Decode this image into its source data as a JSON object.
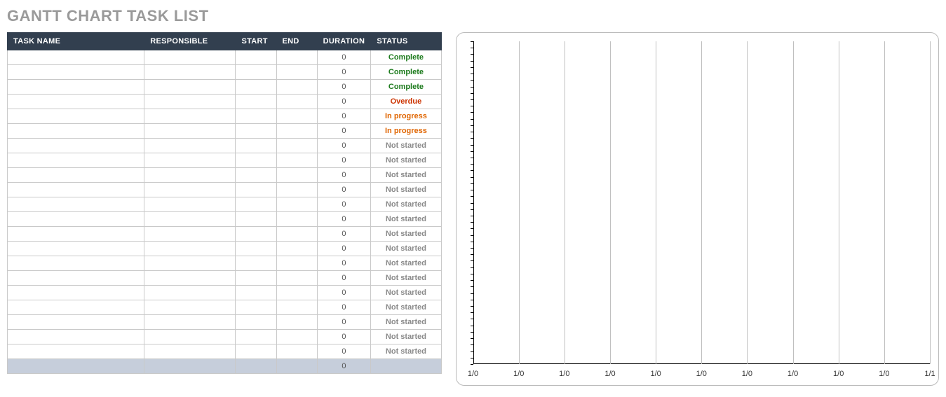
{
  "title": "GANTT CHART TASK LIST",
  "table": {
    "headers": {
      "taskname": "TASK NAME",
      "responsible": "RESPONSIBLE",
      "start": "START",
      "end": "END",
      "duration": "DURATION",
      "status": "STATUS"
    },
    "rows": [
      {
        "taskname": "",
        "responsible": "",
        "start": "",
        "end": "",
        "duration": "0",
        "status": "Complete"
      },
      {
        "taskname": "",
        "responsible": "",
        "start": "",
        "end": "",
        "duration": "0",
        "status": "Complete"
      },
      {
        "taskname": "",
        "responsible": "",
        "start": "",
        "end": "",
        "duration": "0",
        "status": "Complete"
      },
      {
        "taskname": "",
        "responsible": "",
        "start": "",
        "end": "",
        "duration": "0",
        "status": "Overdue"
      },
      {
        "taskname": "",
        "responsible": "",
        "start": "",
        "end": "",
        "duration": "0",
        "status": "In progress"
      },
      {
        "taskname": "",
        "responsible": "",
        "start": "",
        "end": "",
        "duration": "0",
        "status": "In progress"
      },
      {
        "taskname": "",
        "responsible": "",
        "start": "",
        "end": "",
        "duration": "0",
        "status": "Not started"
      },
      {
        "taskname": "",
        "responsible": "",
        "start": "",
        "end": "",
        "duration": "0",
        "status": "Not started"
      },
      {
        "taskname": "",
        "responsible": "",
        "start": "",
        "end": "",
        "duration": "0",
        "status": "Not started"
      },
      {
        "taskname": "",
        "responsible": "",
        "start": "",
        "end": "",
        "duration": "0",
        "status": "Not started"
      },
      {
        "taskname": "",
        "responsible": "",
        "start": "",
        "end": "",
        "duration": "0",
        "status": "Not started"
      },
      {
        "taskname": "",
        "responsible": "",
        "start": "",
        "end": "",
        "duration": "0",
        "status": "Not started"
      },
      {
        "taskname": "",
        "responsible": "",
        "start": "",
        "end": "",
        "duration": "0",
        "status": "Not started"
      },
      {
        "taskname": "",
        "responsible": "",
        "start": "",
        "end": "",
        "duration": "0",
        "status": "Not started"
      },
      {
        "taskname": "",
        "responsible": "",
        "start": "",
        "end": "",
        "duration": "0",
        "status": "Not started"
      },
      {
        "taskname": "",
        "responsible": "",
        "start": "",
        "end": "",
        "duration": "0",
        "status": "Not started"
      },
      {
        "taskname": "",
        "responsible": "",
        "start": "",
        "end": "",
        "duration": "0",
        "status": "Not started"
      },
      {
        "taskname": "",
        "responsible": "",
        "start": "",
        "end": "",
        "duration": "0",
        "status": "Not started"
      },
      {
        "taskname": "",
        "responsible": "",
        "start": "",
        "end": "",
        "duration": "0",
        "status": "Not started"
      },
      {
        "taskname": "",
        "responsible": "",
        "start": "",
        "end": "",
        "duration": "0",
        "status": "Not started"
      },
      {
        "taskname": "",
        "responsible": "",
        "start": "",
        "end": "",
        "duration": "0",
        "status": "Not started"
      }
    ],
    "footer": {
      "taskname": "",
      "responsible": "",
      "start": "",
      "end": "",
      "duration": "0",
      "status": ""
    }
  },
  "chart_data": {
    "type": "bar",
    "categories": [],
    "series": [],
    "x_ticks": [
      "1/0",
      "1/0",
      "1/0",
      "1/0",
      "1/0",
      "1/0",
      "1/0",
      "1/0",
      "1/0",
      "1/0",
      "1/1"
    ],
    "y_tick_count": 50,
    "title": "",
    "xlabel": "",
    "ylabel": ""
  },
  "colors": {
    "header_bg": "#323f4f",
    "complete": "#1d7b1d",
    "overdue": "#cc3300",
    "in_progress": "#e06500",
    "not_started": "#8a8a8a",
    "footer_bg": "#c6cedb"
  }
}
